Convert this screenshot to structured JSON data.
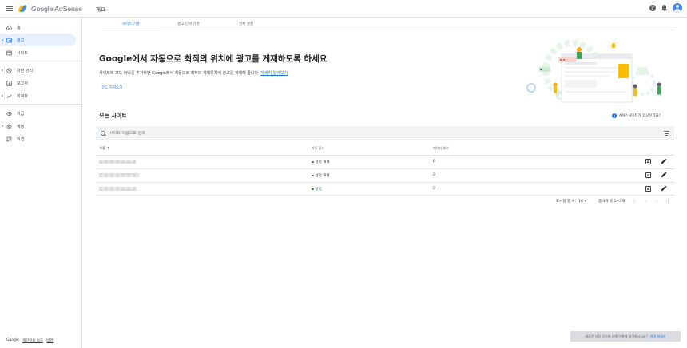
{
  "app": {
    "brand": "Google AdSense",
    "page_title": "개요"
  },
  "sidebar": {
    "items": [
      {
        "label": "홈",
        "icon": "home-icon",
        "active": false
      },
      {
        "label": "광고",
        "icon": "ads-icon",
        "active": true
      },
      {
        "label": "사이트",
        "icon": "sites-icon",
        "active": false
      },
      {
        "label": "차단 관리",
        "icon": "block-icon",
        "active": false
      },
      {
        "label": "보고서",
        "icon": "reports-icon",
        "active": false
      },
      {
        "label": "최적화",
        "icon": "optimize-icon",
        "active": false
      },
      {
        "label": "지급",
        "icon": "payments-icon",
        "active": false
      },
      {
        "label": "계정",
        "icon": "gear-icon",
        "active": false
      },
      {
        "label": "의견",
        "icon": "feedback-icon",
        "active": false
      }
    ],
    "footer": {
      "google": "Google",
      "privacy": "개인정보 보호",
      "terms": "약관"
    }
  },
  "tabs": [
    {
      "label": "사이트 기준",
      "active": true
    },
    {
      "label": "광고 단위 기준",
      "active": false
    },
    {
      "label": "전체 설정",
      "active": false
    }
  ],
  "hero": {
    "title": "Google에서 자동으로 최적의 위치에 광고를 게재하도록 하세요",
    "description": "사이트에 코드 하나를 추가하면 Google에서 자동으로 최적의 게재위치에 광고를 게재해 줍니다.",
    "learn_more": "자세히 알아보기",
    "code_link": "코드 가져오기"
  },
  "sites": {
    "title": "모든 사이트",
    "amp_question": "AMP 사이트가 있으신가요?",
    "search_placeholder": "사이트 이름으로 검색",
    "columns": {
      "name": "이름 ↑",
      "auto_ads": "자동 광고",
      "page_exclusions": "페이지 제외"
    },
    "rows": [
      {
        "status": "설정 해제",
        "on": false,
        "page_exclusions": "0"
      },
      {
        "status": "설정 해제",
        "on": false,
        "page_exclusions": "0"
      },
      {
        "status": "설정",
        "on": true,
        "page_exclusions": "0"
      }
    ]
  },
  "pagination": {
    "rows_label": "표시할 행 수:",
    "rows_value": "10",
    "range": "총 3개 중 1~3개"
  },
  "snackbar": {
    "question": "새로운 자동 광고에 대해 어떻게 생각하시나요?",
    "action": "의견 보내기"
  },
  "colors": {
    "accent": "#1a73e8",
    "active_bg": "#e8f0fe",
    "status_on": "#188038"
  }
}
